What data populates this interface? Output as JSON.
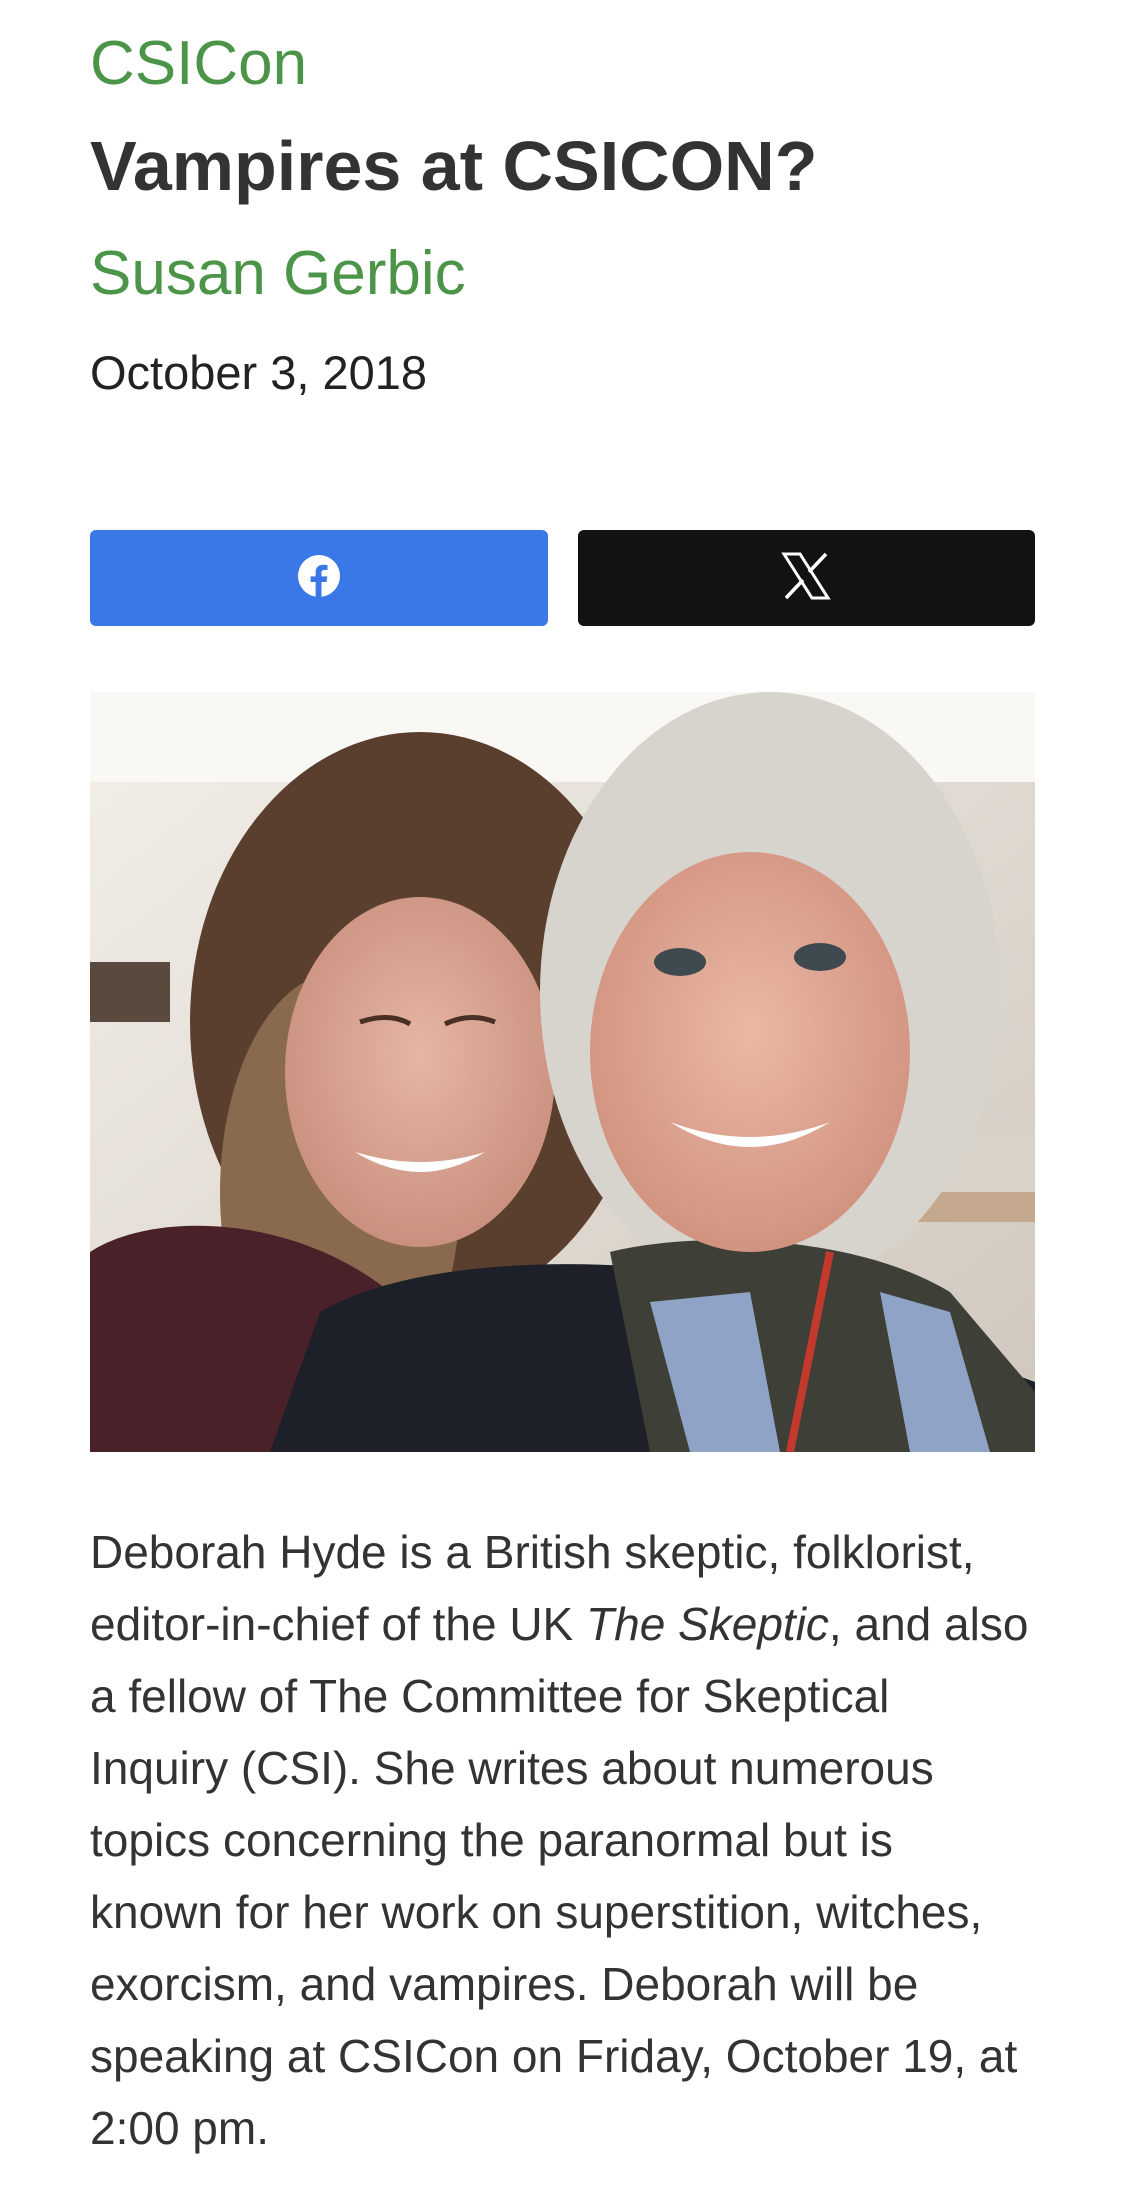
{
  "post": {
    "category": "CSICon",
    "title": "Vampires at CSICON?",
    "author": "Susan Gerbic",
    "date": "October 3, 2018"
  },
  "share": {
    "facebook_icon": "facebook-icon",
    "x_icon": "x-icon"
  },
  "image": {
    "description_icon": "photo"
  },
  "body": {
    "part1": "Deborah Hyde is a British skeptic, folklorist, editor-in-chief of the UK ",
    "italic": "The Skeptic",
    "part2": ", and also a fellow of The Committee for Skeptical Inquiry (CSI). She writes about numerous topics concerning the paranormal but is known for her work on superstition, witches, exorcism, and vampires. Deborah will be speaking at CSICon on Friday, October 19, at 2:00 pm."
  },
  "colors": {
    "accent_green": "#4b9448",
    "facebook_blue": "#3b78e7",
    "x_black": "#111214"
  }
}
